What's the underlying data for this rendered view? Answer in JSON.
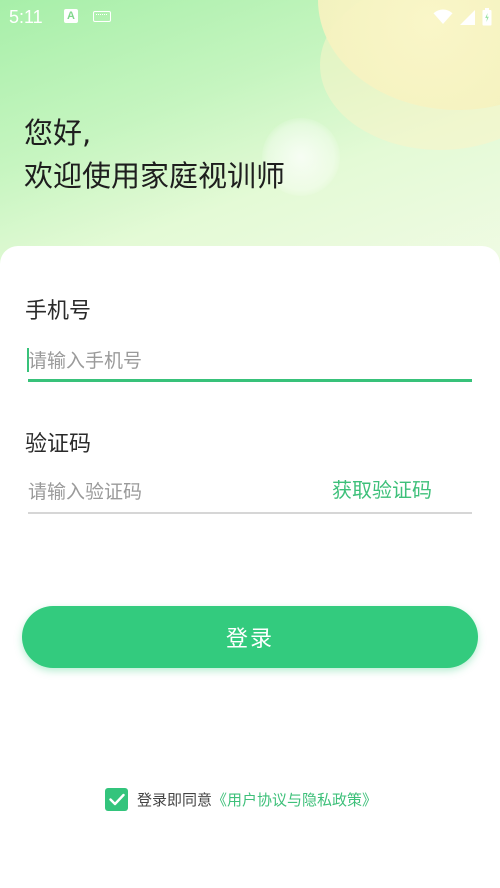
{
  "status_bar": {
    "time": "5:11",
    "notification_icons": [
      "app-a-icon",
      "keyboard-icon"
    ],
    "right_icons": [
      "wifi-icon",
      "signal-icon",
      "battery-icon"
    ]
  },
  "greeting": {
    "line1": "您好,",
    "line2": "欢迎使用家庭视训师"
  },
  "form": {
    "phone_label": "手机号",
    "phone_placeholder": "请输入手机号",
    "phone_value": "",
    "code_label": "验证码",
    "code_placeholder": "请输入验证码",
    "code_value": "",
    "get_code_label": "获取验证码"
  },
  "login_button_label": "登录",
  "agreement": {
    "checked": true,
    "prefix": "登录即同意",
    "link": "《用户协议与隐私政策》"
  },
  "colors": {
    "accent": "#33cb7e",
    "link": "#3ec07a",
    "hero_gradient_start": "#a7efa9"
  }
}
